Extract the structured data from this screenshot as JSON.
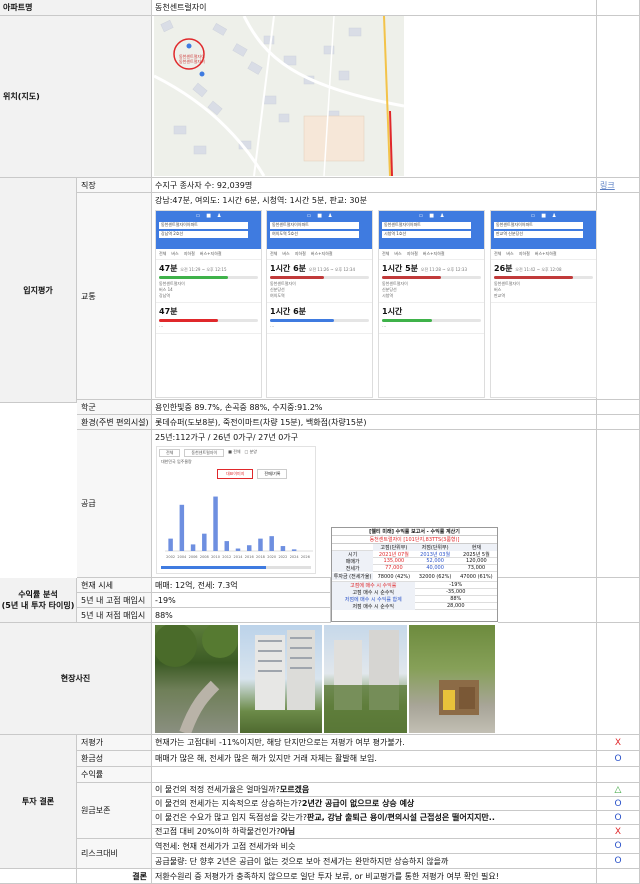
{
  "apt": {
    "label": "아파트명",
    "name": "동천센트럴자이"
  },
  "location": {
    "label": "위치(지도)"
  },
  "location_eval": {
    "label": "입지평가",
    "rows": {
      "job": {
        "label": "직장",
        "value": "수지구 종사자 수: 92,039명",
        "link": "링크"
      },
      "traffic": {
        "label": "교통",
        "value": "강남:47분, 여의도: 1시간 6분, 시청역: 1시간 5분, 판교: 30분"
      },
      "school": {
        "label": "학군",
        "value": "용인한빛중 89.7%, 손곡중 88%, 수지중:91.2%"
      },
      "env": {
        "label": "환경(주변 편의시설)",
        "value": "롯데슈퍼(도보8분), 죽전이마트(차량 15분), 백화점(차량15분)"
      },
      "supply": {
        "label": "공급",
        "value": "25년:112가구 / 26년 0가구/ 27년 0가구"
      }
    }
  },
  "profit": {
    "label": "수익률 분석\n(5년 내 투자 타이밍)",
    "rows": [
      {
        "label": "현재 시세",
        "value": "매매: 12억, 전세: 7.3억"
      },
      {
        "label": "5년 내 고점 매입시",
        "value": "-19%"
      },
      {
        "label": "5년 내 저점 매입시",
        "value": "88%"
      }
    ]
  },
  "photos": {
    "label": "현장사진"
  },
  "conclusion": {
    "label": "투자 결론",
    "rows": [
      {
        "label": "저평가",
        "value": "현재가는 고점대비 -11%이지만, 해당 단지만으로는 저평가 여부 평가불가.",
        "mark": "X",
        "mark_color": "red"
      },
      {
        "label": "환금성",
        "value": "매매가 많은 해, 전세가 많은 해가 있지만 거래 자체는 활발해 보임.",
        "mark": "O",
        "mark_color": "blue"
      },
      {
        "label": "수익률",
        "value": "",
        "mark": "",
        "mark_color": ""
      },
      {
        "label": "",
        "value_pre": "이 물건의 적정 전세가율은 얼마일까?",
        "value_bold": "모르겠음",
        "value_post": "",
        "mark": "△",
        "mark_color": "green"
      },
      {
        "label": "원금보존",
        "value_pre": "이 물건의 전세가는 지속적으로 상승하는가?",
        "value_bold": "2년간 공급이 없으므로 상승 예상",
        "value_post": "",
        "mark": "O",
        "mark_color": "blue"
      },
      {
        "label": "",
        "value_pre": "이 물건은 수요가 많고 입지 독점성을 갖는가?",
        "value_bold": "판교, 강남 출퇴근 용이/편의시설 근접성은 떨어지지만..",
        "value_post": "",
        "mark": "O",
        "mark_color": "blue"
      },
      {
        "label": "",
        "value_pre": "전고점 대비 20%이하 하락물건인가?",
        "value_bold": "아님",
        "value_post": "",
        "mark": "X",
        "mark_color": "red"
      },
      {
        "label": "리스크대비",
        "value": "역전세: 현재 전세가가 고점 전세가와 비슷",
        "mark": "O",
        "mark_color": "blue"
      },
      {
        "label": "",
        "value": "공급물량: 단 향후 2년은 공급이 없는 것으로 보아 전세가는 완만하지만 상승하지 않을까",
        "mark": "O",
        "mark_color": "blue"
      }
    ],
    "final_label": "결론",
    "final_value": "저환수원리 중 저평가가 충족하지 않으므로 일단 투자 보류, or 비교평가를 통한 저평가 여부 확인 필요!"
  },
  "map": {
    "marker_labels": [
      "동천센트럴자이",
      "동천센트럴자이"
    ],
    "pin_label": "동천센트럴자이"
  },
  "routes": [
    {
      "from": "동천센트럴자이아파트",
      "to": "강남역 2호선",
      "time_main": "47분",
      "time_sub": "오전 11:29 ~ 오후 12:15",
      "time2": "47분",
      "stops": [
        "동천센트럴자이",
        "버스 14",
        "강남역"
      ]
    },
    {
      "from": "동천센트럴자이아파트",
      "to": "여의도역 5호선",
      "time_main": "1시간 6분",
      "time_sub": "오전 11:26 ~ 오후 12:34",
      "time2": "1시간 6분",
      "stops": [
        "동천센트럴자이",
        "신분당선",
        "여의도역"
      ]
    },
    {
      "from": "동천센트럴자이아파트",
      "to": "시청역 1호선",
      "time_main": "1시간 5분",
      "time_sub": "오전 11:28 ~ 오후 12:33",
      "time2": "1시간",
      "stops": [
        "동천센트럴자이",
        "신분당선",
        "시청역"
      ]
    },
    {
      "from": "동천센트럴자이아파트",
      "to": "판교역 신분당선",
      "time_main": "26분",
      "time_sub": "오전 11:42 ~ 오후 12:08",
      "time2": "",
      "stops": [
        "동천센트럴자이",
        "버스",
        "판교역"
      ]
    }
  ],
  "supply_chart": {
    "title": "대한민국 입주물량",
    "tab": "전매/기록",
    "chart_data": {
      "type": "bar",
      "title": "",
      "categories": [
        "2002",
        "2004",
        "2006",
        "2008",
        "2010",
        "2012",
        "2014",
        "2016",
        "2018",
        "2020",
        "2022",
        "2024",
        "2026"
      ],
      "values": [
        150,
        560,
        80,
        210,
        660,
        120,
        30,
        70,
        150,
        180,
        60,
        20,
        0
      ],
      "ylim": [
        0,
        800
      ]
    }
  },
  "calc_table": {
    "title": "[웰티 미래] 수익률 보고서 - 수익률 계산기",
    "subtitle": "동천센트럴자이 [101단지,83TTS(3룸형)]",
    "head": [
      "",
      "고점(단위부)",
      "저점(단위부)",
      "현재"
    ],
    "rows": [
      [
        "시기",
        "2021년 07월",
        "2013년 03월",
        "2025년 5월"
      ],
      [
        "매매가",
        "135,000",
        "52,000",
        "120,000"
      ],
      [
        "전세가",
        "77,000",
        "40,000",
        "73,000"
      ],
      [
        "투자금 (전세가율)",
        "78000 (42%)",
        "32000 (62%)",
        "47000 (61%)"
      ],
      [
        "고점에 매수 시 수익률",
        "",
        "-19%",
        ""
      ],
      [
        "고점 매수 시 순수익",
        "",
        "-35,000",
        ""
      ],
      [
        "저점에 매수 시 수익률 합계",
        "",
        "88%",
        ""
      ],
      [
        "저점 매수 시 순수익",
        "",
        "28,000",
        ""
      ]
    ]
  }
}
